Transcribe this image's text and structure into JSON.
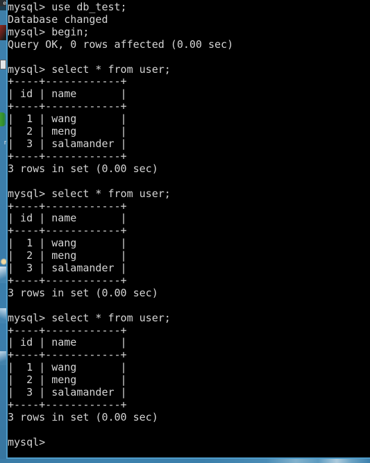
{
  "window": {
    "app": "mysql-terminal",
    "background_color": "#000000",
    "text_color": "#d4d4d4",
    "border_color": "#4e9bc9"
  },
  "desktop": {
    "wallpaper_color": "#3b7eac",
    "accent_green": "#3f9c35",
    "accent_red": "#8e2b22",
    "fragment_labels": [
      "e",
      "r"
    ]
  },
  "session": {
    "prompt": "mysql>",
    "database": "db_test",
    "table": "user",
    "columns": [
      "id",
      "name"
    ],
    "rows": [
      {
        "id": "1",
        "name": "wang"
      },
      {
        "id": "2",
        "name": "meng"
      },
      {
        "id": "3",
        "name": "salamander"
      }
    ],
    "row_count_text": "3 rows in set (0.00 sec)",
    "begin_result": "Query OK, 0 rows affected (0.00 sec)",
    "use_result": "Database changed",
    "commands": {
      "use": "use db_test;",
      "begin": "begin;",
      "select": "select * from user;"
    },
    "separator_top": "+----+------------+",
    "header_row": "| id | name       |",
    "separator_mid": "+----+------------+",
    "data_row_1": "|  1 | wang       |",
    "data_row_2": "|  2 | meng       |",
    "data_row_3": "|  3 | salamander |",
    "separator_bottom": "+----+------------+"
  },
  "terminal_output": "mysql> use db_test;\nDatabase changed\nmysql> begin;\nQuery OK, 0 rows affected (0.00 sec)\n\nmysql> select * from user;\n+----+------------+\n| id | name       |\n+----+------------+\n|  1 | wang       |\n|  2 | meng       |\n|  3 | salamander |\n+----+------------+\n3 rows in set (0.00 sec)\n\nmysql> select * from user;\n+----+------------+\n| id | name       |\n+----+------------+\n|  1 | wang       |\n|  2 | meng       |\n|  3 | salamander |\n+----+------------+\n3 rows in set (0.00 sec)\n\nmysql> select * from user;\n+----+------------+\n| id | name       |\n+----+------------+\n|  1 | wang       |\n|  2 | meng       |\n|  3 | salamander |\n+----+------------+\n3 rows in set (0.00 sec)\n\nmysql>"
}
